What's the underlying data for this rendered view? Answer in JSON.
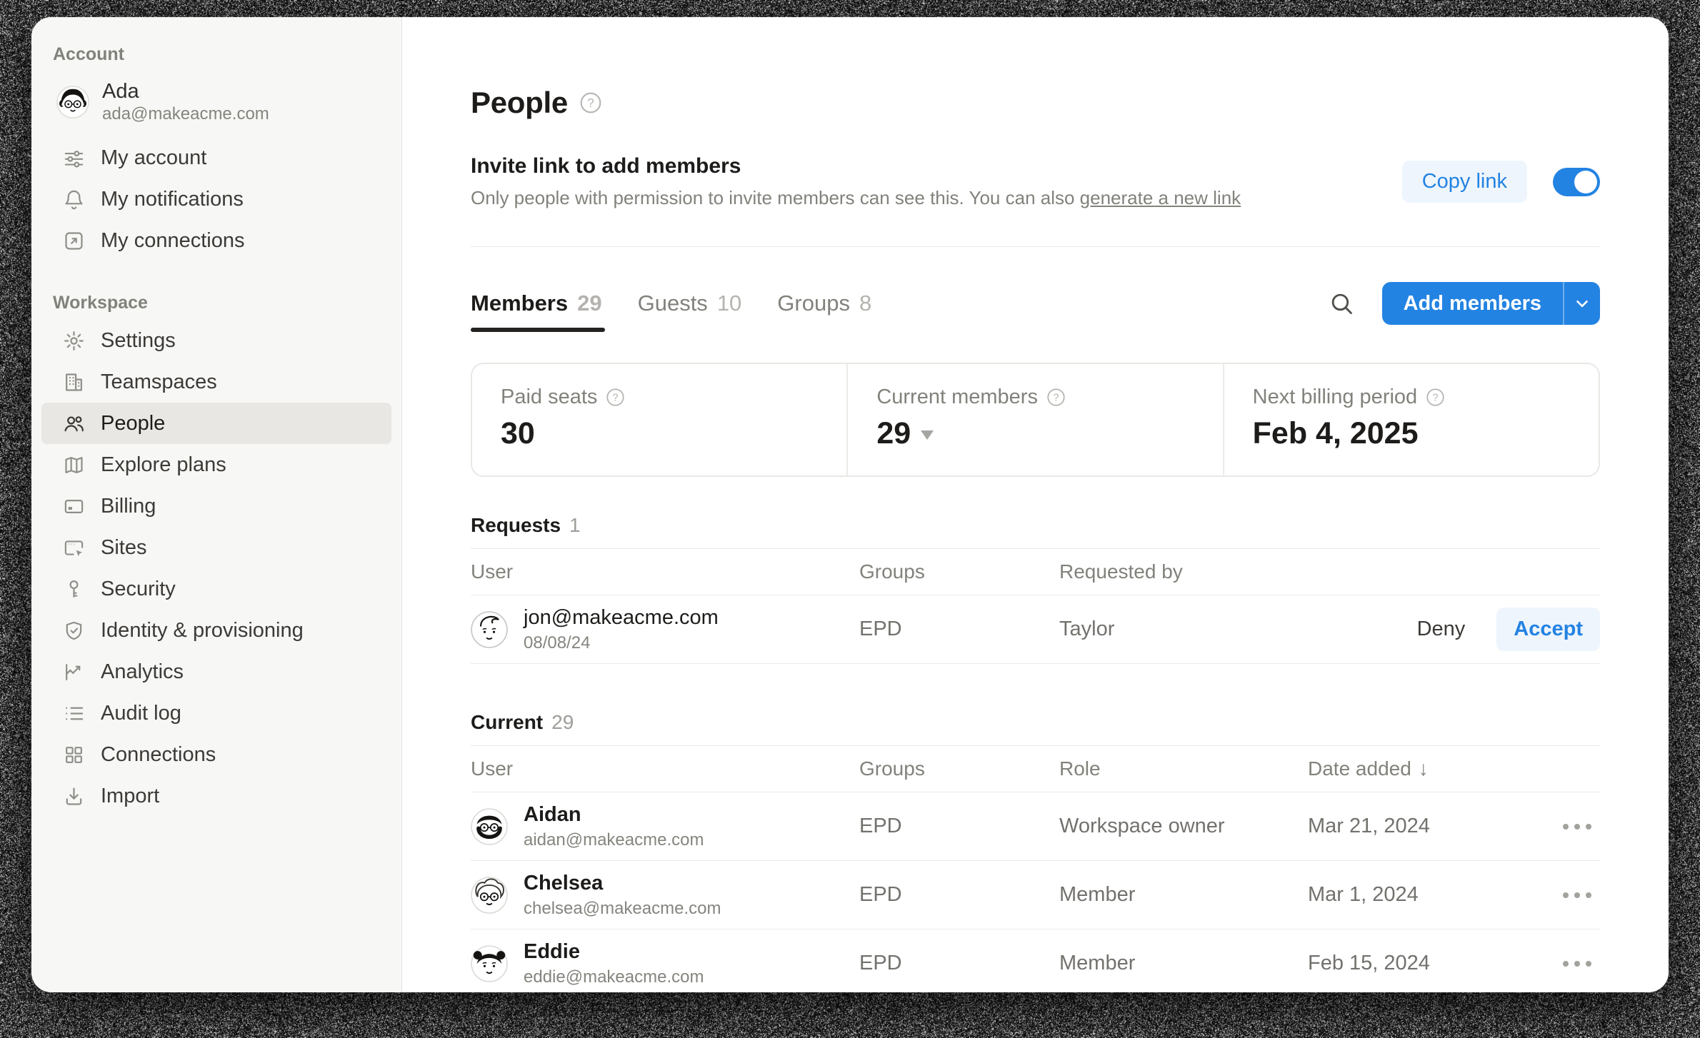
{
  "colors": {
    "accent": "#2383e2",
    "sidebar_bg": "#f7f7f5",
    "active_item_bg": "#e8e7e4",
    "divider": "#ebebe9"
  },
  "icons": {
    "help_glyph": "?"
  },
  "sidebar": {
    "account_label": "Account",
    "user": {
      "name": "Ada",
      "email": "ada@makeacme.com"
    },
    "account_items": [
      {
        "label": "My account",
        "icon": "sliders-icon"
      },
      {
        "label": "My notifications",
        "icon": "bell-icon"
      },
      {
        "label": "My connections",
        "icon": "arrow-up-right-icon"
      }
    ],
    "workspace_label": "Workspace",
    "workspace_items": [
      {
        "label": "Settings",
        "icon": "gear-icon"
      },
      {
        "label": "Teamspaces",
        "icon": "building-icon"
      },
      {
        "label": "People",
        "icon": "people-icon",
        "active": true
      },
      {
        "label": "Explore plans",
        "icon": "map-icon"
      },
      {
        "label": "Billing",
        "icon": "credit-card-icon"
      },
      {
        "label": "Sites",
        "icon": "browser-icon"
      },
      {
        "label": "Security",
        "icon": "key-icon"
      },
      {
        "label": "Identity & provisioning",
        "icon": "shield-check-icon"
      },
      {
        "label": "Analytics",
        "icon": "chart-icon"
      },
      {
        "label": "Audit log",
        "icon": "list-icon"
      },
      {
        "label": "Connections",
        "icon": "grid-icon"
      },
      {
        "label": "Import",
        "icon": "import-icon"
      }
    ]
  },
  "main": {
    "title": "People",
    "invite": {
      "heading": "Invite link to add members",
      "description": "Only people with permission to invite members can see this. You can also ",
      "link_text": "generate a new link",
      "copy_button": "Copy link",
      "toggle_on": true
    },
    "tabs": [
      {
        "label": "Members",
        "count": "29",
        "active": true
      },
      {
        "label": "Guests",
        "count": "10",
        "active": false
      },
      {
        "label": "Groups",
        "count": "8",
        "active": false
      }
    ],
    "add_members_button": "Add members",
    "stats": [
      {
        "label": "Paid seats",
        "value": "30"
      },
      {
        "label": "Current members",
        "value": "29",
        "has_dropdown": true
      },
      {
        "label": "Next billing period",
        "value": "Feb 4, 2025"
      }
    ],
    "requests": {
      "heading": "Requests",
      "count": "1",
      "columns": [
        "User",
        "Groups",
        "Requested by"
      ],
      "deny_label": "Deny",
      "accept_label": "Accept",
      "rows": [
        {
          "email": "jon@makeacme.com",
          "date": "08/08/24",
          "groups": "EPD",
          "requested_by": "Taylor"
        }
      ]
    },
    "current": {
      "heading": "Current",
      "count": "29",
      "columns": [
        "User",
        "Groups",
        "Role",
        "Date added"
      ],
      "sort_indicator": "↓",
      "rows": [
        {
          "name": "Aidan",
          "email": "aidan@makeacme.com",
          "groups": "EPD",
          "role": "Workspace owner",
          "date": "Mar 21, 2024"
        },
        {
          "name": "Chelsea",
          "email": "chelsea@makeacme.com",
          "groups": "EPD",
          "role": "Member",
          "date": "Mar 1, 2024"
        },
        {
          "name": "Eddie",
          "email": "eddie@makeacme.com",
          "groups": "EPD",
          "role": "Member",
          "date": "Feb 15, 2024"
        }
      ]
    }
  }
}
